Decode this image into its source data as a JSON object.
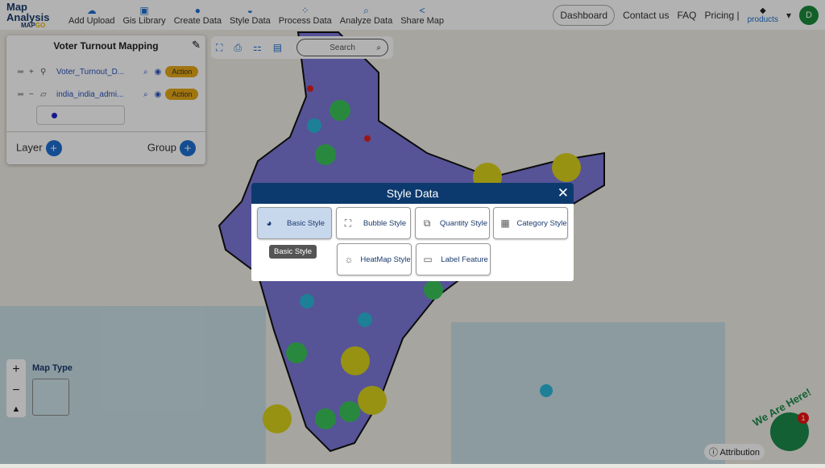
{
  "header": {
    "logo_title": "Map Analysis",
    "logo_sub": "MAP",
    "logo_sub2": "GO",
    "nav": [
      {
        "label": "Add Upload",
        "icon": "cloud-upload-icon"
      },
      {
        "label": "Gis Library",
        "icon": "library-icon"
      },
      {
        "label": "Create Data",
        "icon": "location-pin-icon"
      },
      {
        "label": "Style Data",
        "icon": "paint-bucket-icon"
      },
      {
        "label": "Process Data",
        "icon": "process-icon"
      },
      {
        "label": "Analyze Data",
        "icon": "analyze-icon"
      },
      {
        "label": "Share Map",
        "icon": "share-icon"
      }
    ],
    "dashboard": "Dashboard",
    "contact": "Contact us",
    "faq": "FAQ",
    "pricing": "Pricing |",
    "products": "products",
    "avatar": "D"
  },
  "panel": {
    "title": "Voter Turnout Mapping",
    "layers": [
      {
        "name": "Voter_Turnout_D...",
        "action": "Action"
      },
      {
        "name": "india_india_admi...",
        "action": "Action"
      }
    ],
    "layer_label": "Layer",
    "group_label": "Group"
  },
  "toolbar": {
    "search_placeholder": "Search"
  },
  "map": {
    "map_type": "Map Type",
    "attribution": "Attribution",
    "chat_banner": "We Are Here!",
    "chat_badge": "1",
    "polygon_color": "#7b78d8"
  },
  "modal": {
    "title": "Style Data",
    "options": [
      "Basic Style",
      "Bubble Style",
      "Quantity Style",
      "Category Style",
      "HeatMap Style",
      "Label Feature"
    ],
    "selected": "Basic Style",
    "tooltip": "Basic Style"
  }
}
